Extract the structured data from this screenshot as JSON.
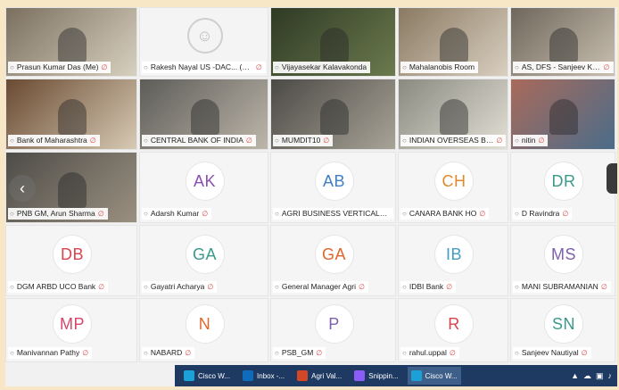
{
  "participants": [
    {
      "name": "Prasun Kumar Das (Me)",
      "type": "video",
      "muted": true,
      "bg": [
        "#7b7060",
        "#d8d0bf"
      ]
    },
    {
      "name": "Rakesh Nayal US -DAC... (Host)",
      "type": "placeholder",
      "muted": true
    },
    {
      "name": "Vijayasekar Kalavakonda",
      "type": "video",
      "muted": false,
      "bg": [
        "#2f3a24",
        "#6b7a4e"
      ]
    },
    {
      "name": "Mahalanobis Room",
      "type": "video",
      "muted": false,
      "bg": [
        "#8a7a62",
        "#d9cfc0"
      ]
    },
    {
      "name": "AS, DFS - Sanjeev Kaushik",
      "type": "video",
      "muted": true,
      "bg": [
        "#6f675c",
        "#c9c0b0"
      ]
    },
    {
      "name": "Bank of Maharashtra",
      "type": "video",
      "muted": true,
      "bg": [
        "#6a4a32",
        "#d7cab4"
      ]
    },
    {
      "name": "CENTRAL BANK OF INDIA",
      "type": "video",
      "muted": true,
      "bg": [
        "#5d5c58",
        "#bdb6aa"
      ]
    },
    {
      "name": "MUMDIT10",
      "type": "video",
      "muted": true,
      "bg": [
        "#4c4a46",
        "#a8a397"
      ]
    },
    {
      "name": "INDIAN OVERSEAS BANK CEN...",
      "type": "video",
      "muted": true,
      "bg": [
        "#8a8a80",
        "#e3e0d6"
      ]
    },
    {
      "name": "nitin",
      "type": "video",
      "muted": true,
      "bg": [
        "#a96a5a",
        "#4a6c8a"
      ]
    },
    {
      "name": "PNB GM, Arun Sharma",
      "type": "video",
      "muted": true,
      "bg": [
        "#4e4c48",
        "#9a9080"
      ]
    },
    {
      "name": "Adarsh Kumar",
      "type": "avatar",
      "initials": "AK",
      "color": "#8a4fb0",
      "muted": true
    },
    {
      "name": "AGRI BUSINESS VERTICAL-UNI...",
      "type": "avatar",
      "initials": "AB",
      "color": "#3f7fc2",
      "muted": false
    },
    {
      "name": "CANARA BANK HO",
      "type": "avatar",
      "initials": "CH",
      "color": "#e08a2c",
      "muted": true
    },
    {
      "name": "D Ravindra",
      "type": "avatar",
      "initials": "DR",
      "color": "#3a9a8a",
      "muted": true
    },
    {
      "name": "DGM ARBD UCO Bank",
      "type": "avatar",
      "initials": "DB",
      "color": "#d6454f",
      "muted": true
    },
    {
      "name": "Gayatri Acharya",
      "type": "avatar",
      "initials": "GA",
      "color": "#3a9a8a",
      "muted": true
    },
    {
      "name": "General Manager Agri",
      "type": "avatar",
      "initials": "GA",
      "color": "#e0662c",
      "muted": true
    },
    {
      "name": "IDBI Bank",
      "type": "avatar",
      "initials": "IB",
      "color": "#3f9ec2",
      "muted": true
    },
    {
      "name": "MANI SUBRAMANIAN",
      "type": "avatar",
      "initials": "MS",
      "color": "#7f5fb0",
      "muted": true
    },
    {
      "name": "Manivannan Pathy",
      "type": "avatar",
      "initials": "MP",
      "color": "#d6456a",
      "muted": true
    },
    {
      "name": "NABARD",
      "type": "avatar",
      "initials": "N",
      "color": "#e0662c",
      "muted": true
    },
    {
      "name": "PSB_GM",
      "type": "avatar",
      "initials": "P",
      "color": "#7f5fb0",
      "muted": true
    },
    {
      "name": "rahul.uppal",
      "type": "avatar",
      "initials": "R",
      "color": "#d6454f",
      "muted": true
    },
    {
      "name": "Sanjeev Nautiyal",
      "type": "avatar",
      "initials": "SN",
      "color": "#3a9a8a",
      "muted": true
    }
  ],
  "taskbar": {
    "items": [
      {
        "label": "Cisco W...",
        "color": "#1ba0d7",
        "active": false
      },
      {
        "label": "Inbox -...",
        "color": "#0f6cbd",
        "active": false
      },
      {
        "label": "Agri Val...",
        "color": "#d24726",
        "active": false
      },
      {
        "label": "Snippin...",
        "color": "#8b5cf6",
        "active": false
      },
      {
        "label": "Cisco W...",
        "color": "#1ba0d7",
        "active": true
      }
    ]
  }
}
